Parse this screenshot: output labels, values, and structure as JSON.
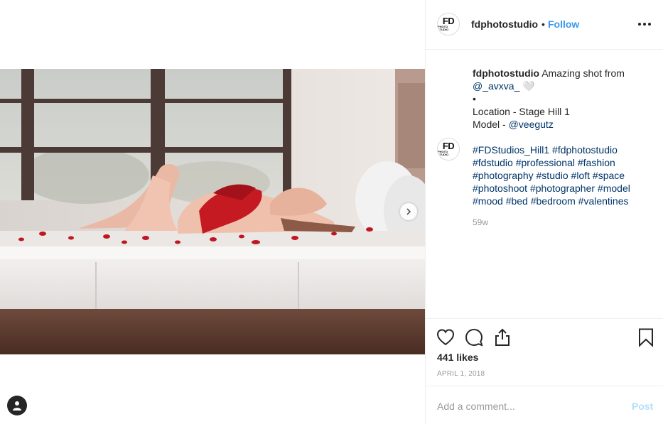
{
  "post": {
    "username": "fdphotostudio",
    "separator": "•",
    "follow_label": "Follow",
    "avatar_text": "FD",
    "avatar_subtext": "PHOTO STUDIO"
  },
  "caption": {
    "username": "fdphotostudio",
    "text": "Amazing shot from",
    "mention": "@_avxva_ 🤍",
    "bullet": "•",
    "location_line": "Location - Stage Hill 1",
    "model_prefix": "Model - ",
    "model_handle": "@veegutz"
  },
  "hashtag_comment": {
    "lines": [
      "#FDStudios_Hill1 #fdphotostudio",
      "#fdstudio #professional #fashion",
      "#photography #studio #loft #space",
      "#photoshoot #photographer #model",
      "#mood #bed #bedroom #valentines"
    ],
    "time_ago": "59w"
  },
  "engagement": {
    "likes": "441 likes",
    "date": "APRIL 1, 2018"
  },
  "comment_box": {
    "placeholder": "Add a comment...",
    "post_label": "Post"
  },
  "icons": {
    "more": "more-options-icon",
    "like": "heart-icon",
    "comment": "comment-icon",
    "share": "share-icon",
    "save": "bookmark-icon",
    "next": "chevron-right-icon",
    "account": "account-icon"
  },
  "colors": {
    "link_blue": "#3897f0",
    "hashtag_blue": "#003569",
    "muted_text": "#999999",
    "post_disabled": "#b2dffc",
    "border": "#efefef"
  }
}
